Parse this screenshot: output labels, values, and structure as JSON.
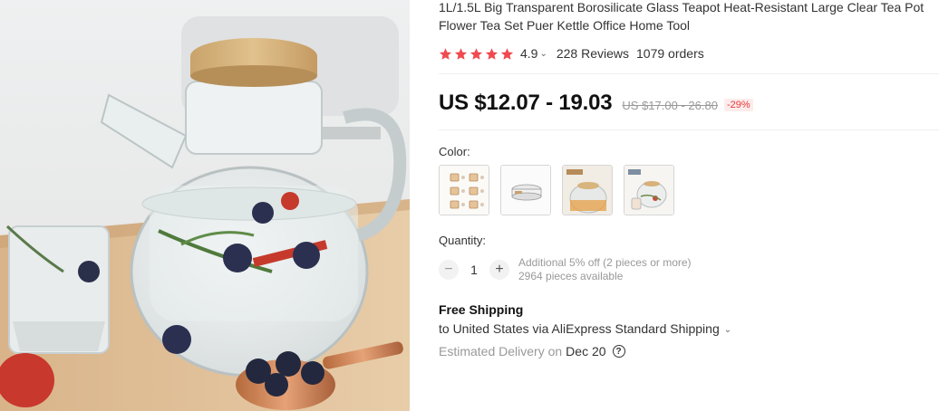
{
  "product": {
    "title_line1": "1L/1.5L Big Transparent Borosilicate Glass Teapot Heat-Resistant Large Clear Tea Pot",
    "title_line2": "Flower Tea Set Puer Kettle Office Home Tool"
  },
  "rating": {
    "stars": 5,
    "value": "4.9",
    "reviews": "228 Reviews",
    "orders": "1079 orders",
    "star_color": "#f0494f"
  },
  "price": {
    "current": "US $12.07 - 19.03",
    "original": "US $17.00 - 26.80",
    "discount": "-29%"
  },
  "color_section": {
    "label": "Color:",
    "options": [
      {
        "icon": "six-cups-thumbnail"
      },
      {
        "icon": "tray-thumbnail"
      },
      {
        "icon": "teapot-lid-thumbnail"
      },
      {
        "icon": "teapot-set-thumbnail"
      }
    ]
  },
  "quantity": {
    "label": "Quantity:",
    "value": "1",
    "minus_icon": "minus-icon",
    "plus_icon": "plus-icon",
    "note": "Additional 5% off (2 pieces or more)",
    "available": "2964 pieces available"
  },
  "shipping": {
    "title": "Free Shipping",
    "destination": "to United States via AliExpress Standard Shipping",
    "eta_label": "Estimated Delivery on",
    "eta_date": "Dec 20"
  }
}
